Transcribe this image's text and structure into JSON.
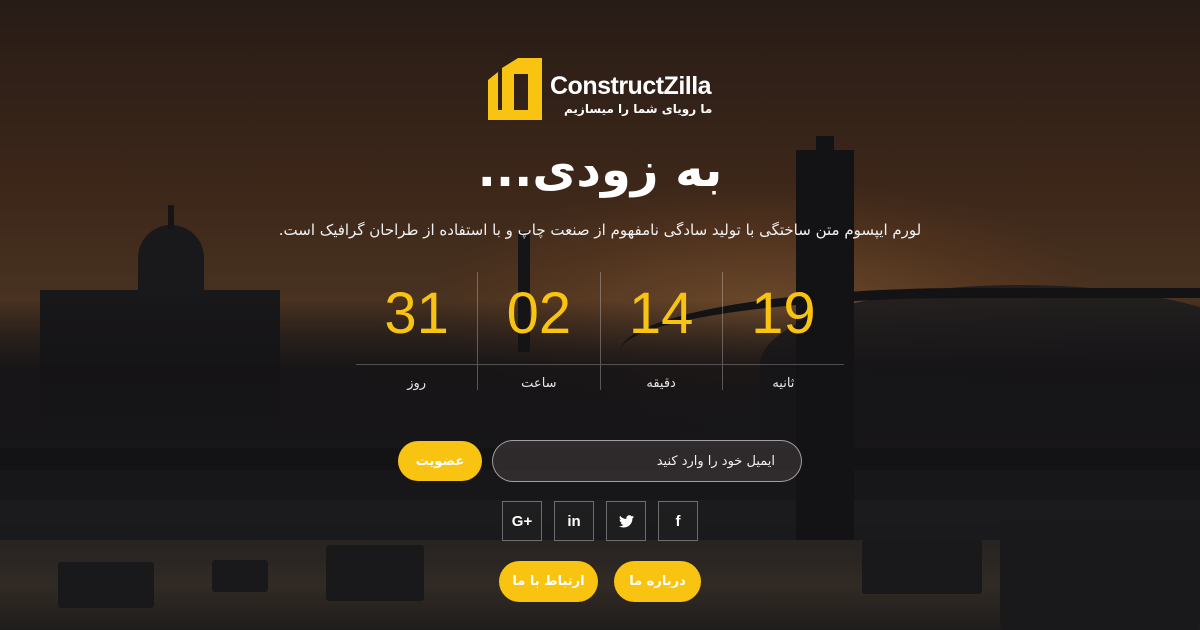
{
  "brand": {
    "name": "ConstructZilla",
    "tagline": "ما رویای شما را میسازیم",
    "accent_color": "#f9c311"
  },
  "hero": {
    "headline": "به زودی...",
    "subtitle": "لورم ایپسوم متن ساختگی با تولید سادگی نامفهوم از صنعت چاپ و با استفاده از طراحان گرافیک است."
  },
  "countdown": {
    "days": {
      "value": "31",
      "label": "روز"
    },
    "hours": {
      "value": "02",
      "label": "ساعت"
    },
    "minutes": {
      "value": "14",
      "label": "دقیقه"
    },
    "seconds": {
      "value": "19",
      "label": "ثانیه"
    }
  },
  "subscribe": {
    "email_placeholder": "ایمیل خود را وارد کنید",
    "button_label": "عضویت"
  },
  "social": [
    {
      "icon": "google-plus-icon",
      "glyph": "G+"
    },
    {
      "icon": "linkedin-icon",
      "glyph": "in"
    },
    {
      "icon": "twitter-icon",
      "glyph": "🐦"
    },
    {
      "icon": "facebook-icon",
      "glyph": "f"
    }
  ],
  "nav_buttons": {
    "contact_label": "ارتباط با ما",
    "about_label": "درباره ما"
  }
}
